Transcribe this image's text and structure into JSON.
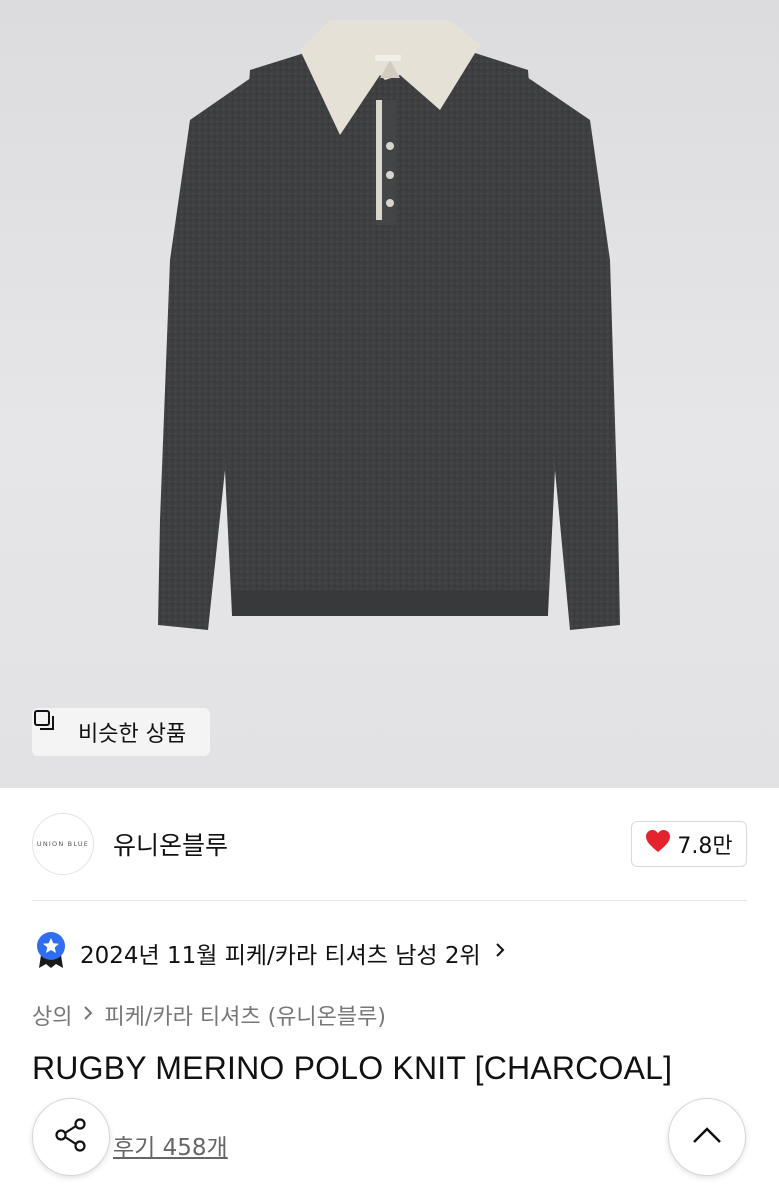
{
  "similar_button": {
    "label": "비슷한 상품"
  },
  "brand": {
    "logo_text": "UNION BLUE",
    "name": "유니온블루"
  },
  "likes": {
    "count": "7.8만"
  },
  "ranking": {
    "text": "2024년 11월 피케/카라 티셔츠 남성 2위"
  },
  "breadcrumb": {
    "root": "상의",
    "current": "피케/카라 티셔츠 (유니온블루)"
  },
  "product": {
    "title": "RUGBY MERINO POLO KNIT [CHARCOAL]"
  },
  "reviews": {
    "label": "후기 458개"
  },
  "colors": {
    "heart": "#e5232e",
    "badge": "#2f6ef0",
    "sweater": "#3e3f41",
    "collar": "#e6e1d6"
  }
}
